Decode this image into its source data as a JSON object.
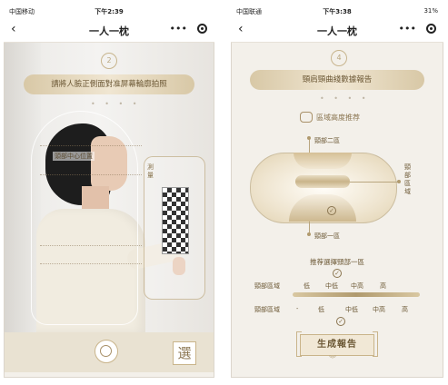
{
  "left": {
    "status": {
      "carrier": "中国移动",
      "time": "下午2:39",
      "right": ""
    },
    "nav": {
      "back": "‹",
      "title": "一人一枕",
      "more": "•••"
    },
    "step": "2",
    "banner": "請將人臉正側面對准屏幕輪廓拍照",
    "dots": "• • • •",
    "head_label": "頭部中心位置",
    "card_label": "測量",
    "select_label": "選"
  },
  "right": {
    "status": {
      "carrier": "中国联通",
      "time": "下午3:38",
      "battery": "31%"
    },
    "nav": {
      "back": "‹",
      "title": "一人一枕",
      "more": "•••"
    },
    "step": "4",
    "banner": "頸肩頸曲綫數據報告",
    "section_title": "區域高度推荐",
    "zone_two": "頸部二區",
    "zone_side": "頸部區域",
    "zone_one": "頸部一區",
    "recommend": "推荐選擇頸部一區",
    "row1": {
      "label": "頸部區域",
      "values": [
        "低",
        "中低",
        "中高",
        "高"
      ]
    },
    "row2": {
      "label": "頸部區域",
      "values": [
        "-",
        "低",
        "中低",
        "中高",
        "高"
      ]
    },
    "generate_button": "生成報告",
    "chevron": "︾",
    "check": "✓"
  }
}
